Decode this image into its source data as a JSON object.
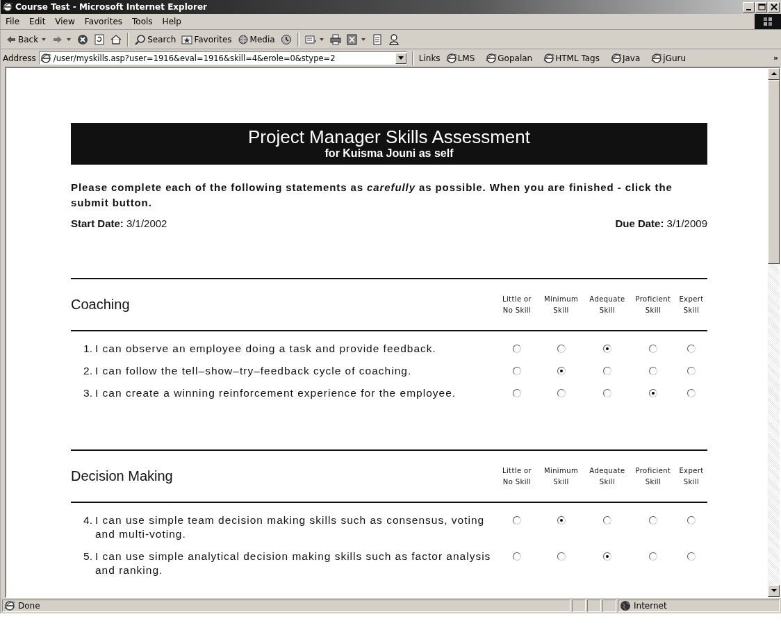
{
  "window": {
    "title": "Course Test - Microsoft Internet Explorer"
  },
  "menu": [
    {
      "label": "File"
    },
    {
      "label": "Edit"
    },
    {
      "label": "View"
    },
    {
      "label": "Favorites"
    },
    {
      "label": "Tools"
    },
    {
      "label": "Help"
    }
  ],
  "toolbar": [
    {
      "kind": "back",
      "label": "Back"
    },
    {
      "kind": "forward"
    },
    {
      "kind": "stop"
    },
    {
      "kind": "refresh"
    },
    {
      "kind": "home"
    },
    {
      "kind": "search",
      "label": "Search"
    },
    {
      "kind": "favorites",
      "label": "Favorites"
    },
    {
      "kind": "media",
      "label": "Media"
    },
    {
      "kind": "history"
    },
    {
      "kind": "mail"
    },
    {
      "kind": "print"
    },
    {
      "kind": "edit"
    },
    {
      "kind": "discuss"
    },
    {
      "kind": "messenger"
    }
  ],
  "address": {
    "label": "Address",
    "value": "/user/myskills.asp?user=1916&eval=1916&skill=4&erole=0&stype=2"
  },
  "links": {
    "label": "Links",
    "items": [
      "LMS",
      "Gopalan",
      "HTML Tags",
      "Java",
      "jGuru"
    ],
    "more": "»"
  },
  "page": {
    "title": "Project Manager Skills Assessment",
    "subtitle": "for Kuisma Jouni as self",
    "instructions": "Please complete each of the following statements as *carefully* as possible. When you are finished - click the submit button.",
    "start_date": {
      "label": "Start Date:",
      "value": "3/1/2002"
    },
    "due_date": {
      "label": "Due Date:",
      "value": "3/1/2009"
    },
    "sections": [
      {
        "title": "Coaching",
        "scale": [
          [
            "Little or",
            "No Skill"
          ],
          [
            "Minimum",
            "Skill"
          ],
          [
            "Adequate",
            "Skill"
          ],
          [
            "Proficient",
            "Skill"
          ],
          [
            "Expert",
            "Skill"
          ]
        ],
        "items": [
          {
            "number": "1.",
            "text": "I can observe an employee doing a task and provide feedback.",
            "choices": [
              {
                "selected": false
              },
              {
                "selected": false
              },
              {
                "selected": true
              },
              {
                "selected": false
              },
              {
                "selected": false
              }
            ]
          },
          {
            "number": "2.",
            "text": "I can follow the tell–show–try–feedback cycle of coaching.",
            "choices": [
              {
                "selected": false
              },
              {
                "selected": true
              },
              {
                "selected": false
              },
              {
                "selected": false
              },
              {
                "selected": false
              }
            ]
          },
          {
            "number": "3.",
            "text": "I can create a winning reinforcement experience for the employee.",
            "choices": [
              {
                "selected": false
              },
              {
                "selected": false
              },
              {
                "selected": false
              },
              {
                "selected": true
              },
              {
                "selected": false
              }
            ]
          }
        ]
      },
      {
        "title": "Decision Making",
        "scale": [
          [
            "Little or",
            "No Skill"
          ],
          [
            "Minimum",
            "Skill"
          ],
          [
            "Adequate",
            "Skill"
          ],
          [
            "Proficient",
            "Skill"
          ],
          [
            "Expert",
            "Skill"
          ]
        ],
        "items": [
          {
            "number": "4.",
            "text": "I can use simple team decision making skills such as consensus, voting and multi-voting.",
            "choices": [
              {
                "selected": false
              },
              {
                "selected": true
              },
              {
                "selected": false
              },
              {
                "selected": false
              },
              {
                "selected": false
              }
            ]
          },
          {
            "number": "5.",
            "text": "I can use simple analytical decision making skills such as factor analysis and ranking.",
            "choices": [
              {
                "selected": false
              },
              {
                "selected": false
              },
              {
                "selected": true
              },
              {
                "selected": false
              },
              {
                "selected": false
              }
            ]
          }
        ]
      }
    ]
  },
  "status_bar": {
    "text": "Done",
    "zone": "Internet"
  }
}
